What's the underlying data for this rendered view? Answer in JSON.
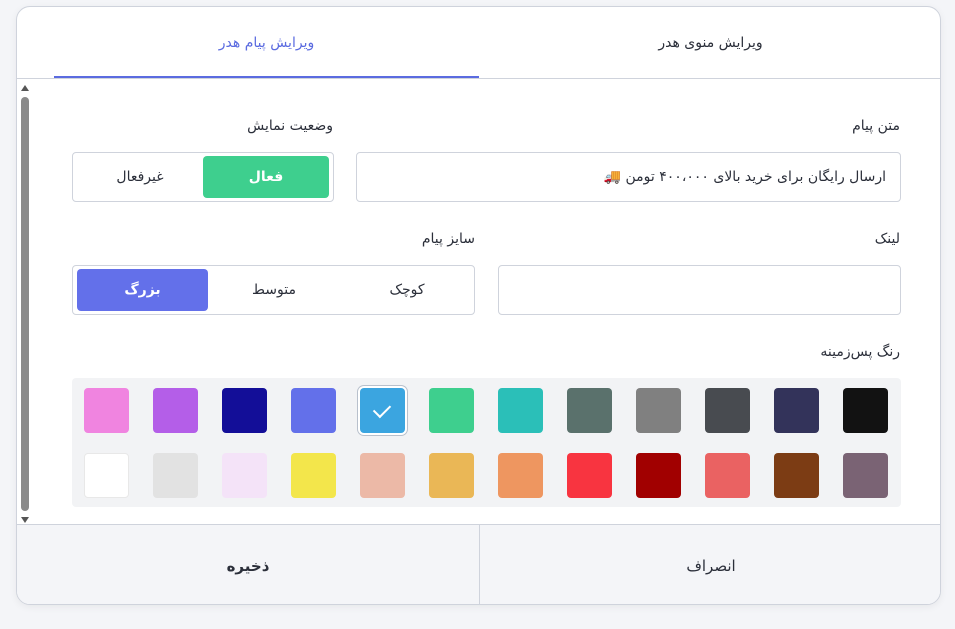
{
  "tabs": [
    {
      "label": "ویرایش منوی هدر",
      "active": false
    },
    {
      "label": "ویرایش پیام هدر",
      "active": true
    }
  ],
  "message": {
    "label": "متن پیام",
    "value": "ارسال رایگان برای خرید بالای ۴۰۰،۰۰۰ تومن 🚚"
  },
  "status": {
    "label": "وضعیت نمایش",
    "options": [
      "فعال",
      "غیرفعال"
    ],
    "selected": "فعال"
  },
  "link": {
    "label": "لینک",
    "value": ""
  },
  "size": {
    "label": "سایز پیام",
    "options": [
      "کوچک",
      "متوسط",
      "بزرگ"
    ],
    "selected": "بزرگ"
  },
  "background": {
    "label": "رنگ پس‌زمینه",
    "row1": [
      "#121212",
      "#33335a",
      "#484b50",
      "#808080",
      "#5a716c",
      "#2bbfb8",
      "#3ecf8e",
      "#3ba5e0",
      "#6370ea",
      "#130e98",
      "#b45ee8",
      "#f084e0"
    ],
    "row2": [
      "#7a6374",
      "#7c3c14",
      "#ea6262",
      "#a10000",
      "#f83440",
      "#ee9660",
      "#eab756",
      "#ecb9a7",
      "#f3e64b",
      "#f4e3f8",
      "#e2e2e2",
      "#ffffff"
    ],
    "selected": "#3ba5e0"
  },
  "footer": {
    "cancel": "انصراف",
    "save": "ذخیره"
  },
  "colors": {
    "accent_blue": "#6370ea",
    "accent_green": "#3ecf8e"
  }
}
